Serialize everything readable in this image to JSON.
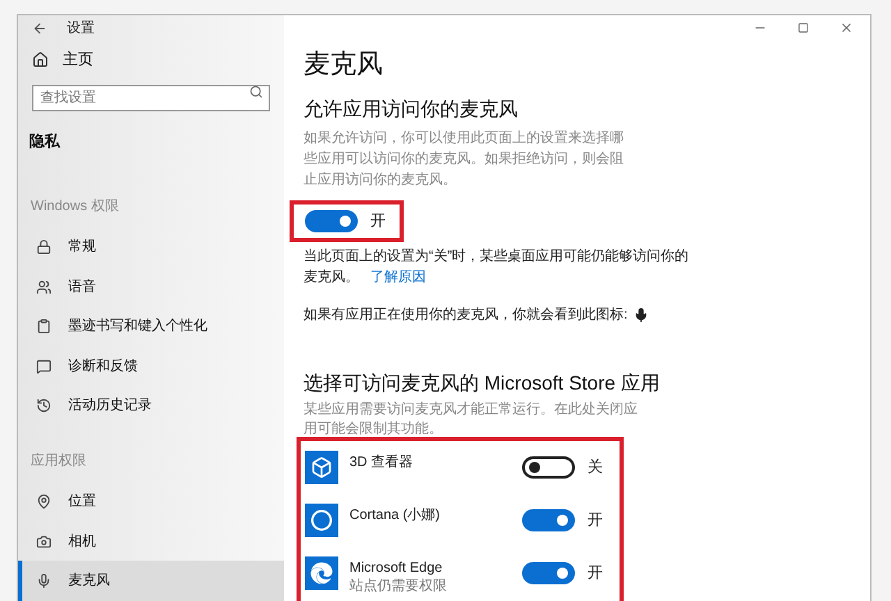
{
  "window": {
    "title": "设置"
  },
  "sidebar": {
    "home": "主页",
    "search": {
      "placeholder": "查找设置"
    },
    "section": "隐私",
    "groups": [
      {
        "heading": "Windows 权限",
        "items": [
          {
            "label": "常规",
            "selected": false
          },
          {
            "label": "语音",
            "selected": false
          },
          {
            "label": "墨迹书写和键入个性化",
            "selected": false
          },
          {
            "label": "诊断和反馈",
            "selected": false
          },
          {
            "label": "活动历史记录",
            "selected": false
          }
        ]
      },
      {
        "heading": "应用权限",
        "items": [
          {
            "label": "位置",
            "selected": false
          },
          {
            "label": "相机",
            "selected": false
          },
          {
            "label": "麦克风",
            "selected": true
          }
        ]
      }
    ]
  },
  "main": {
    "title": "麦克风",
    "access": {
      "heading": "允许应用访问你的麦克风",
      "description": "如果允许访问，你可以使用此页面上的设置来选择哪些应用可以访问你的麦克风。如果拒绝访问，则会阻止应用访问你的麦克风。",
      "toggle": {
        "on": true,
        "label": "开"
      },
      "note": "当此页面上的设置为“关”时，某些桌面应用可能仍能够访问你的麦克风。",
      "link": "了解原因",
      "indicator": "如果有应用正在使用你的麦克风，你就会看到此图标:"
    },
    "apps": {
      "heading": "选择可访问麦克风的 Microsoft Store 应用",
      "description": "某些应用需要访问麦克风才能正常运行。在此处关闭应用可能会限制其功能。",
      "items": [
        {
          "name": "3D 查看器",
          "on": false,
          "label": "关"
        },
        {
          "name": "Cortana (小娜)",
          "on": true,
          "label": "开"
        },
        {
          "name": "Microsoft Edge",
          "subtitle": "站点仍需要权限",
          "on": true,
          "label": "开"
        }
      ]
    }
  }
}
